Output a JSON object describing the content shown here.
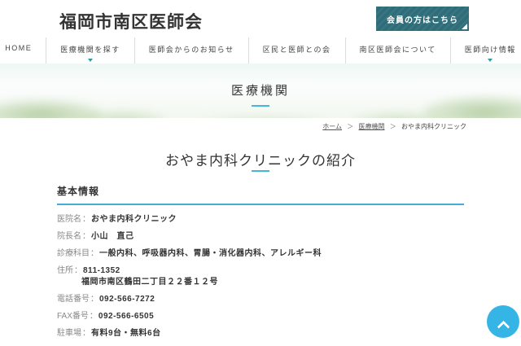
{
  "header": {
    "site_title": "福岡市南区医師会",
    "member_button_label": "会員の方はこちら"
  },
  "nav": {
    "items": [
      {
        "label": "HOME",
        "has_dropdown": false
      },
      {
        "label": "医療機関を探す",
        "has_dropdown": true
      },
      {
        "label": "医師会からのお知らせ",
        "has_dropdown": false
      },
      {
        "label": "区民と医師との会",
        "has_dropdown": false
      },
      {
        "label": "南区医師会について",
        "has_dropdown": false
      },
      {
        "label": "医師向け情報",
        "has_dropdown": true
      }
    ]
  },
  "hero": {
    "title": "医療機関"
  },
  "breadcrumb": {
    "separator": "＞",
    "items": [
      "ホーム",
      "医療機関",
      "おやま内科クリニック"
    ]
  },
  "page": {
    "title": "おやま内科クリニックの紹介"
  },
  "basic_info": {
    "section_title": "基本情報",
    "label_separator": "：",
    "rows": [
      {
        "label": "医院名",
        "value": "おやま内科クリニック"
      },
      {
        "label": "院長名",
        "value": "小山　直己"
      },
      {
        "label": "診療科目",
        "value": "一般内科、呼吸器内科、胃腸・消化器内科、アレルギー科"
      },
      {
        "label": "住所",
        "value": "811-1352",
        "value_line2": "福岡市南区鶴田二丁目２２番１２号"
      },
      {
        "label": "電話番号",
        "value": "092-566-7272"
      },
      {
        "label": "FAX番号",
        "value": "092-566-6505"
      },
      {
        "label": "駐車場",
        "value": "有料9台・無料6台"
      }
    ]
  },
  "icons": {
    "dropdown": "chevron-down",
    "scroll_top": "chevron-up"
  },
  "colors": {
    "brand_teal": "#2e6d79",
    "accent_cyan": "#45b8d8",
    "section_underline": "#46aed6",
    "scroll_button": "#35b5e6",
    "text_dark": "#333333",
    "label_gray": "#888888",
    "teal_band": "#abdcd5"
  }
}
